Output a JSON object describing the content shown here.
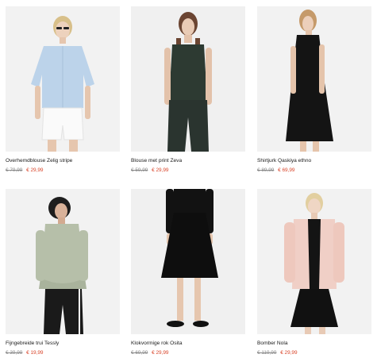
{
  "products": [
    {
      "name": "Overhemdblouse Zelig stripe",
      "old_price": "€ 79,99",
      "new_price": "€ 29,99"
    },
    {
      "name": "Blouse met print Zeva",
      "old_price": "€ 59,99",
      "new_price": "€ 29,99"
    },
    {
      "name": "Shirtjurk Qaskiya ethno",
      "old_price": "€ 89,99",
      "new_price": "€ 69,99"
    },
    {
      "name": "Fijngebreide trui Tessly",
      "old_price": "€ 39,99",
      "new_price": "€ 19,99"
    },
    {
      "name": "Klokvormige rok Osita",
      "old_price": "€ 69,99",
      "new_price": "€ 29,99"
    },
    {
      "name": "Bomber Nola",
      "old_price": "€ 119,99",
      "new_price": "€ 29,99"
    }
  ],
  "colors": {
    "sale": "#d9452a",
    "old_price": "#8a8a8a",
    "photo_bg": "#f3f3f3"
  }
}
